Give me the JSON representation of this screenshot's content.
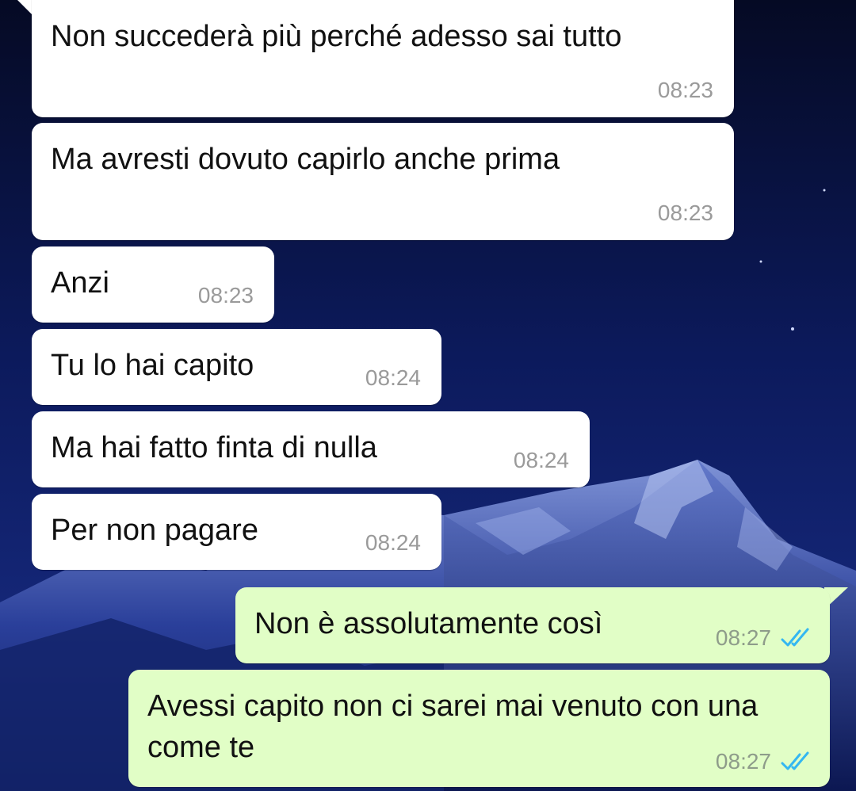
{
  "theme": {
    "incoming_bubble": "#ffffff",
    "outgoing_bubble": "#e1fec6",
    "read_tick_color": "#34b7f1",
    "wallpaper": "night sky with snowy mountain"
  },
  "messages": [
    {
      "direction": "incoming",
      "text": "Non succederà più perché adesso sai tutto",
      "time": "08:23"
    },
    {
      "direction": "incoming",
      "text": "Ma avresti dovuto capirlo anche prima",
      "time": "08:23"
    },
    {
      "direction": "incoming",
      "text": "Anzi",
      "time": "08:23"
    },
    {
      "direction": "incoming",
      "text": "Tu lo hai capito",
      "time": "08:24"
    },
    {
      "direction": "incoming",
      "text": "Ma hai fatto finta di nulla",
      "time": "08:24"
    },
    {
      "direction": "incoming",
      "text": "Per non pagare",
      "time": "08:24"
    },
    {
      "direction": "outgoing",
      "text": "Non è assolutamente così",
      "time": "08:27",
      "status": "read",
      "status_icon": "double-check-icon"
    },
    {
      "direction": "outgoing",
      "text": "Avessi capito non ci sarei mai venuto con una come te",
      "time": "08:27",
      "status": "read",
      "status_icon": "double-check-icon"
    }
  ]
}
